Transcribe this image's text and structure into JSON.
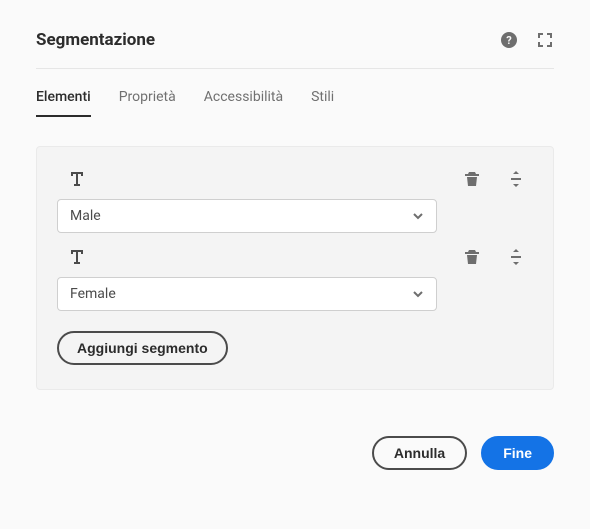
{
  "header": {
    "title": "Segmentazione"
  },
  "tabs": [
    {
      "label": "Elementi",
      "active": true
    },
    {
      "label": "Proprietà",
      "active": false
    },
    {
      "label": "Accessibilità",
      "active": false
    },
    {
      "label": "Stili",
      "active": false
    }
  ],
  "segments": [
    {
      "value": "Male"
    },
    {
      "value": "Female"
    }
  ],
  "buttons": {
    "add": "Aggiungi segmento",
    "cancel": "Annulla",
    "done": "Fine"
  }
}
